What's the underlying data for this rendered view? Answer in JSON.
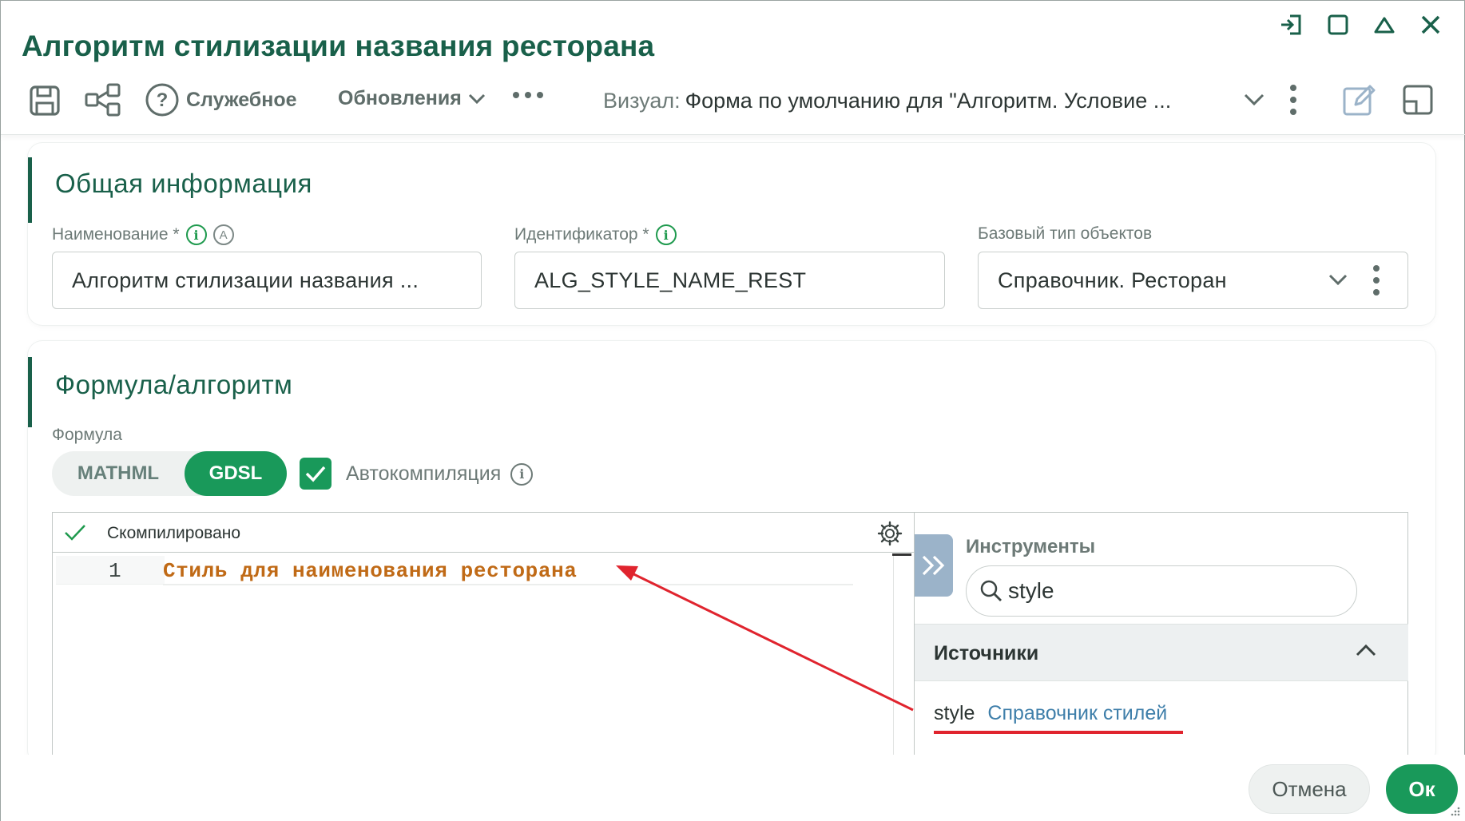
{
  "window": {
    "title": "Алгоритм стилизации названия ресторана"
  },
  "toolbar": {
    "help_label": "Служебное",
    "updates_label": "Обновления",
    "visual_label": "Визуал:",
    "visual_value": "Форма по умолчанию для \"Алгоритм. Условие ..."
  },
  "general": {
    "section_title": "Общая информация",
    "name_label": "Наименование *",
    "name_value": "Алгоритм стилизации названия ...",
    "id_label": "Идентификатор *",
    "id_value": "ALG_STYLE_NAME_REST",
    "base_type_label": "Базовый тип объектов",
    "base_type_value": "Справочник. Ресторан"
  },
  "formula": {
    "section_title": "Формула/алгоритм",
    "formula_label": "Формула",
    "mode_options": [
      "MATHML",
      "GDSL"
    ],
    "mode_selected": "GDSL",
    "autocompile_label": "Автокомпиляция",
    "autocompile_checked": true,
    "status_text": "Скомпилировано",
    "line_number": "1",
    "code_line": "Стиль для наименования ресторана"
  },
  "tools": {
    "title": "Инструменты",
    "search_value": "style",
    "sources_title": "Источники",
    "source_item_name": "style",
    "source_item_desc": "Справочник стилей"
  },
  "footer": {
    "cancel_label": "Отмена",
    "ok_label": "Ок"
  },
  "colors": {
    "accent": "#19604a",
    "primary_button": "#19995a",
    "code_text": "#c06a16",
    "annotation_red": "#e0242e",
    "link": "#3f7faa"
  }
}
